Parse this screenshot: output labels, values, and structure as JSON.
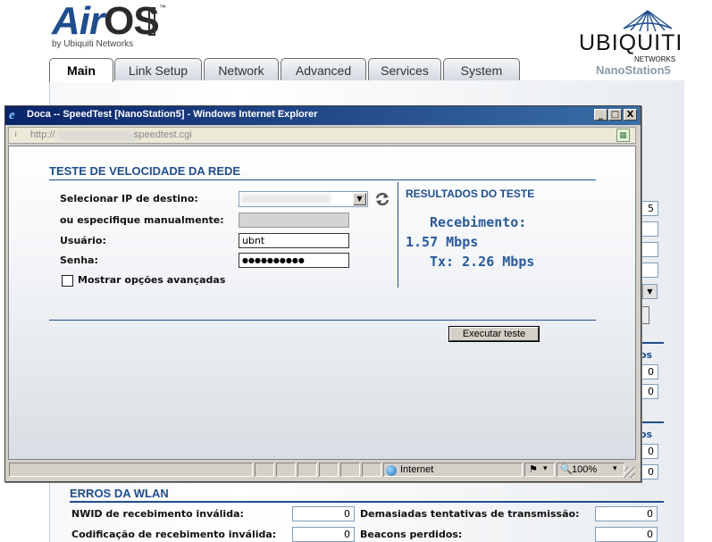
{
  "airos": {
    "logo_text_air": "Air",
    "logo_text_os": "OS",
    "logo_tm": "™",
    "logo_sub": "by Ubiquiti Networks",
    "brand_name": "UBIQUITI",
    "brand_sub": "NETWORKS",
    "device_name": "NanoStation5",
    "tabs": [
      {
        "label": "Main",
        "active": true
      },
      {
        "label": "Link Setup",
        "active": false
      },
      {
        "label": "Network",
        "active": false
      },
      {
        "label": "Advanced",
        "active": false
      },
      {
        "label": "Services",
        "active": false
      },
      {
        "label": "System",
        "active": false
      }
    ],
    "partial_texts": {
      "field_5": "5",
      "os_1": "os",
      "os_2": "os"
    },
    "partial_values": {
      "v1": "0",
      "v2": "0",
      "v3": "0",
      "v4": "0"
    },
    "wlan_errors": {
      "title": "ERROS DA WLAN",
      "rows": [
        {
          "label": "NWID de recebimento inválida:",
          "value": "0"
        },
        {
          "label": "Demasiadas tentativas de transmissão:",
          "value": "0"
        },
        {
          "label": "Codificação de recebimento inválida:",
          "value": "0"
        },
        {
          "label": "Beacons perdidos:",
          "value": "0"
        }
      ]
    }
  },
  "ie": {
    "window_title": "Doca -- SpeedTest [NanoStation5] - Windows Internet Explorer",
    "minimize": "_",
    "maximize": "□",
    "close": "X",
    "address_prefix": "http://",
    "address_path": "speedtest.cgi",
    "status": {
      "zone": "Internet",
      "zoom": "100%",
      "zoom_arrow": "▾",
      "protect_arrow": "▾"
    }
  },
  "speedtest": {
    "title": "TESTE DE VELOCIDADE DA REDE",
    "labels": {
      "dest_ip": "Selecionar IP de destino:",
      "manual": "ou especifique manualmente:",
      "user": "Usuário:",
      "password": "Senha:",
      "advanced": "Mostrar opções avançadas"
    },
    "user_value": "ubnt",
    "password_value": "●●●●●●●●●●",
    "results": {
      "title": "RESULTADOS DO TESTE",
      "rx_label": "Recebimento:",
      "rx_value": "1.57 Mbps",
      "tx_line": "Tx: 2.26 Mbps"
    },
    "run_button": "Executar teste"
  }
}
